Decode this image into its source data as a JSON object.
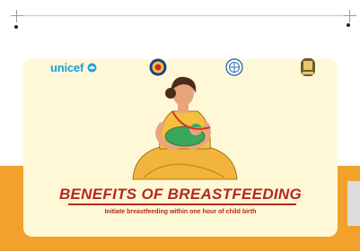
{
  "logos": {
    "unicef_text": "unicef"
  },
  "poster": {
    "title": "BENEFITS OF BREASTFEEDING",
    "subtitle": "Initiate breastfeeding within one hour of child birth"
  },
  "colors": {
    "band": "#f2a22c",
    "sheet": "#fff8d6",
    "title": "#b4281e",
    "unicef_blue": "#1aa0dc"
  },
  "icons": {
    "unicef_globe": "unicef-globe-icon",
    "emblem_left": "state-emblem-icon",
    "emblem_center": "health-mission-emblem-icon",
    "emblem_right": "government-seal-icon"
  }
}
